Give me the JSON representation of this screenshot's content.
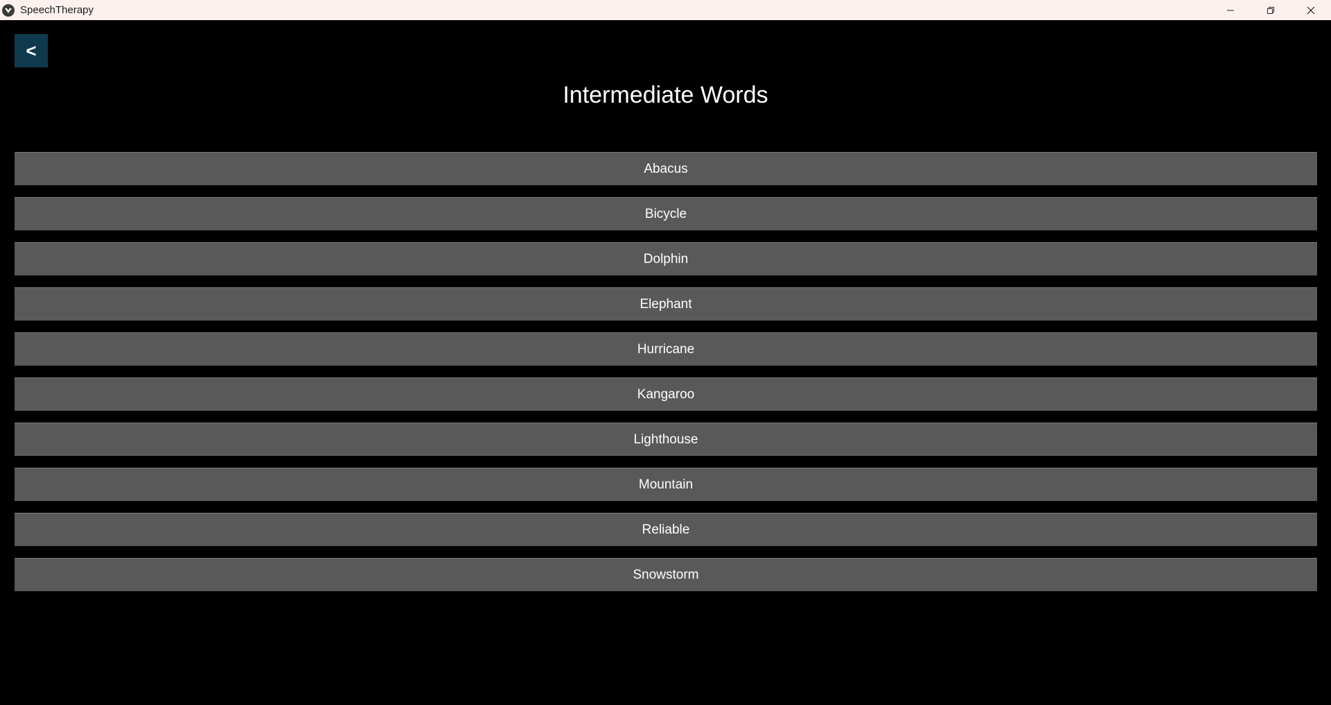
{
  "window": {
    "title": "SpeechTherapy",
    "controls": [
      "minimize-icon",
      "restore-icon",
      "close-icon"
    ]
  },
  "header": {
    "back_label": "<",
    "title": "Intermediate Words"
  },
  "words": [
    {
      "label": "Abacus"
    },
    {
      "label": "Bicycle"
    },
    {
      "label": "Dolphin"
    },
    {
      "label": "Elephant"
    },
    {
      "label": "Hurricane"
    },
    {
      "label": "Kangaroo"
    },
    {
      "label": "Lighthouse"
    },
    {
      "label": "Mountain"
    },
    {
      "label": "Reliable"
    },
    {
      "label": "Snowstorm"
    }
  ],
  "colors": {
    "background": "#000000",
    "titlebar": "#fcf1ee",
    "back_button": "#0f3a4e",
    "word_button": "#595959",
    "text": "#ffffff"
  }
}
